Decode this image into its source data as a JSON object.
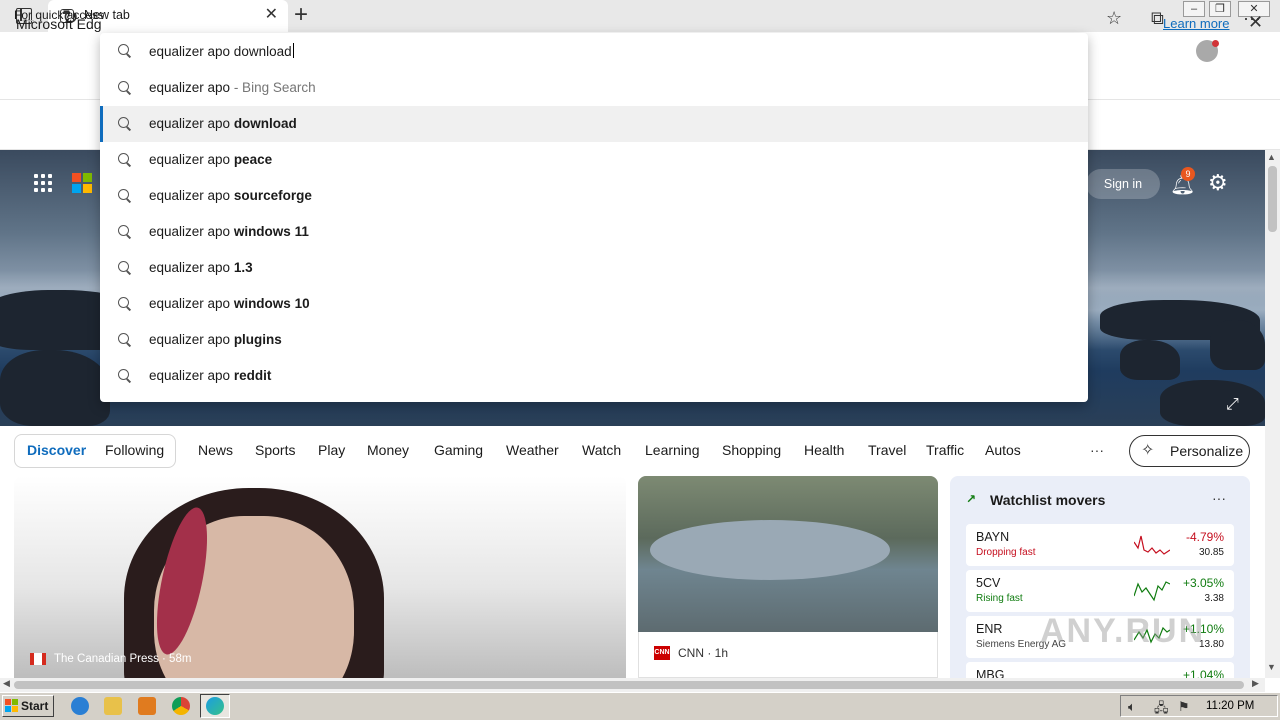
{
  "browser": {
    "tab_title": "New tab",
    "favorites_hint": "For quick access",
    "info_bar_text": "Microsoft Edg",
    "info_bar_link": "Learn more"
  },
  "address_bar": {
    "value": "equalizer apo download"
  },
  "suggestions": [
    {
      "prefix": "equalizer apo",
      "bold": "",
      "suffix": " - Bing Search"
    },
    {
      "prefix": "equalizer apo ",
      "bold": "download",
      "suffix": ""
    },
    {
      "prefix": "equalizer apo ",
      "bold": "peace",
      "suffix": ""
    },
    {
      "prefix": "equalizer apo ",
      "bold": "sourceforge",
      "suffix": ""
    },
    {
      "prefix": "equalizer apo ",
      "bold": "windows 11",
      "suffix": ""
    },
    {
      "prefix": "equalizer apo ",
      "bold": "1.3",
      "suffix": ""
    },
    {
      "prefix": "equalizer apo ",
      "bold": "windows 10",
      "suffix": ""
    },
    {
      "prefix": "equalizer apo ",
      "bold": "plugins",
      "suffix": ""
    },
    {
      "prefix": "equalizer apo ",
      "bold": "reddit",
      "suffix": ""
    }
  ],
  "selected_suggestion": 1,
  "hero": {
    "sign_in": "Sign in",
    "notification_count": "9"
  },
  "feed_nav": {
    "discover": "Discover",
    "following": "Following",
    "categories": [
      "News",
      "Sports",
      "Play",
      "Money",
      "Gaming",
      "Weather",
      "Watch",
      "Learning",
      "Shopping",
      "Health",
      "Travel",
      "Traffic",
      "Autos"
    ],
    "more": "···",
    "personalize": "Personalize"
  },
  "cards": {
    "main_source": "The Canadian Press · 58m",
    "cnn_logo": "CNN",
    "cnn_source": "CNN · 1h"
  },
  "watchlist": {
    "title": "Watchlist movers",
    "stocks": [
      {
        "symbol": "BAYN",
        "subtitle": "Dropping fast",
        "change": "-4.79%",
        "price": "30.85",
        "direction": "down"
      },
      {
        "symbol": "5CV",
        "subtitle": "Rising fast",
        "change": "+3.05%",
        "price": "3.38",
        "direction": "up"
      },
      {
        "symbol": "ENR",
        "subtitle": "Siemens Energy AG",
        "change": "+1.10%",
        "price": "13.80",
        "direction": "up"
      },
      {
        "symbol": "MBG",
        "subtitle": "",
        "change": "+1.04%",
        "price": "",
        "direction": "up"
      }
    ]
  },
  "watermark": "ANY.RUN",
  "taskbar": {
    "start_label": "Start",
    "clock": "11:20 PM"
  },
  "colors": {
    "accent": "#0f6cbd",
    "down": "#c50f1f",
    "up": "#107c10"
  }
}
